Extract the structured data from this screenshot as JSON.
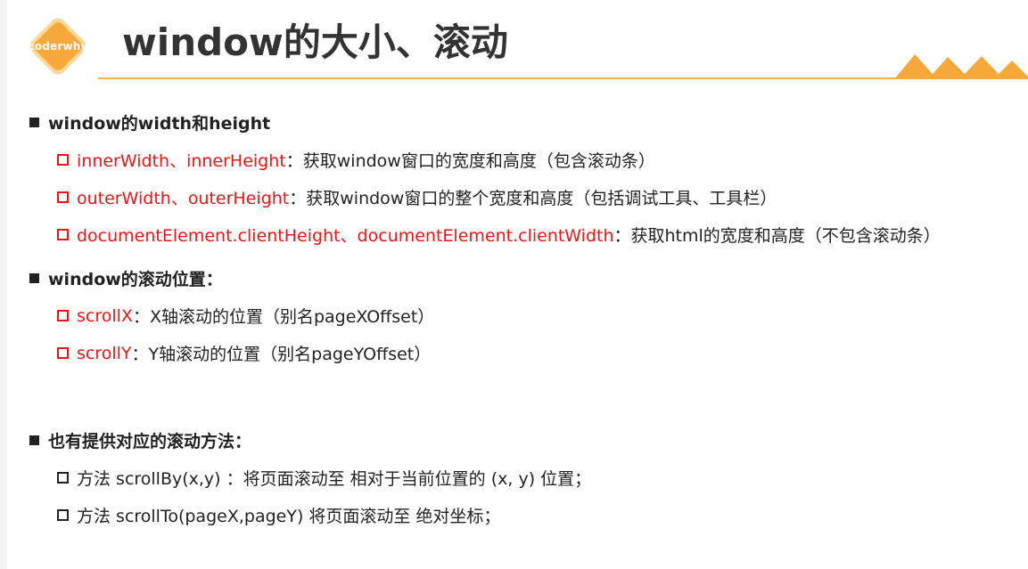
{
  "header": {
    "logo_text": "coderwhy",
    "title": "window的大小、滚动",
    "accent_color": "#f4b141"
  },
  "sections": [
    {
      "heading": "window的width和height",
      "items": [
        {
          "red_text": "innerWidth、innerHeight",
          "text": "：获取window窗口的宽度和高度（包含滚动条）"
        },
        {
          "red_text": "outerWidth、outerHeight",
          "text": "：获取window窗口的整个宽度和高度（包括调试工具、工具栏）"
        },
        {
          "red_text": "documentElement.clientHeight、documentElement.clientWidth",
          "text": "：获取html的宽度和高度（不包含滚动条）"
        }
      ]
    },
    {
      "heading": "window的滚动位置：",
      "items": [
        {
          "red_text": "scrollX",
          "text": "：X轴滚动的位置（别名pageXOffset）"
        },
        {
          "red_text": "scrollY",
          "text": "：Y轴滚动的位置（别名pageYOffset）"
        }
      ]
    },
    {
      "heading": "也有提供对应的滚动方法：",
      "items": [
        {
          "text": "方法 scrollBy(x,y) ：将页面滚动至 相对于当前位置的 (x, y) 位置；"
        },
        {
          "text": "方法 scrollTo(pageX,pageY) 将页面滚动至 绝对坐标；"
        }
      ]
    }
  ],
  "colors": {
    "red": "#e31818",
    "logo_orange": "#f4a93a",
    "text": "#222222"
  }
}
